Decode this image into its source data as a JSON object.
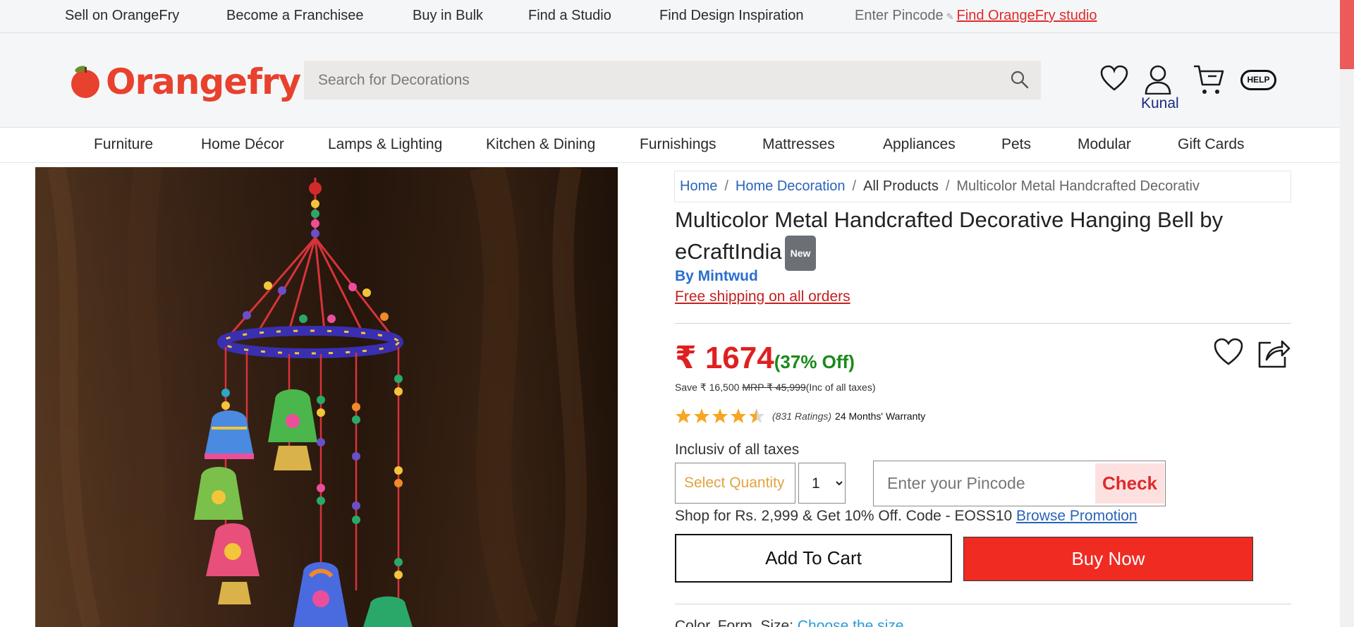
{
  "topbar": {
    "links": [
      "Sell on OrangeFry",
      "Become a Franchisee",
      "Buy in Bulk",
      "Find a Studio",
      "Find Design Inspiration"
    ],
    "pincode_label": "Enter Pincode",
    "studio_link": "Find OrangeFry studio"
  },
  "header": {
    "logo_text": "Orangefry",
    "search_placeholder": "Search for Decorations",
    "user_name": "Kunal",
    "help_label": "HELP",
    "icons": [
      "heart-icon",
      "user-icon",
      "cart-icon",
      "help-icon",
      "search-icon"
    ]
  },
  "categories": [
    "Furniture",
    "Home Décor",
    "Lamps & Lighting",
    "Kitchen & Dining",
    "Furnishings",
    "Mattresses",
    "Appliances",
    "Pets",
    "Modular",
    "Gift Cards"
  ],
  "breadcrumb": {
    "home": "Home",
    "category": "Home Decoration",
    "all_products": "All Products",
    "current": "Multicolor Metal Handcrafted Decorativ"
  },
  "product": {
    "title": "Multicolor Metal Handcrafted Decorative Hanging Bell by eCraftIndia",
    "badge": "New",
    "brand": "By Mintwud",
    "free_shipping": "Free shipping on all orders",
    "price": "₹ 1674",
    "discount": "(37% Off)",
    "save_text": "Save ₹ 16,500",
    "mrp_text": "MRP ₹ 45,999",
    "tax_note": "(Inc of all taxes)",
    "rating": 4.5,
    "rating_max": 5,
    "ratings_count": "(831 Ratings)",
    "warranty": "24 Months' Warranty",
    "inclusive_text": "Inclusiv of all taxes",
    "select_quantity_label": "Select Quantity",
    "quantity_value": "1",
    "pincode_placeholder": "Enter your Pincode",
    "check_label": "Check",
    "promo_text": "Shop for Rs. 2,999 & Get 10% Off. Code - EOSS10",
    "promo_link": "Browse Promotion",
    "add_to_cart": "Add To Cart",
    "buy_now": "Buy Now",
    "size_label": "Color, Form, Size:",
    "size_link": "Choose the size"
  },
  "colors": {
    "brand_red": "#e8412d",
    "price_red": "#e01f1f",
    "discount_green": "#1a8a1a",
    "link_blue": "#2a64b8",
    "buy_now_bg": "#f02b22",
    "star": "#f6a623"
  }
}
